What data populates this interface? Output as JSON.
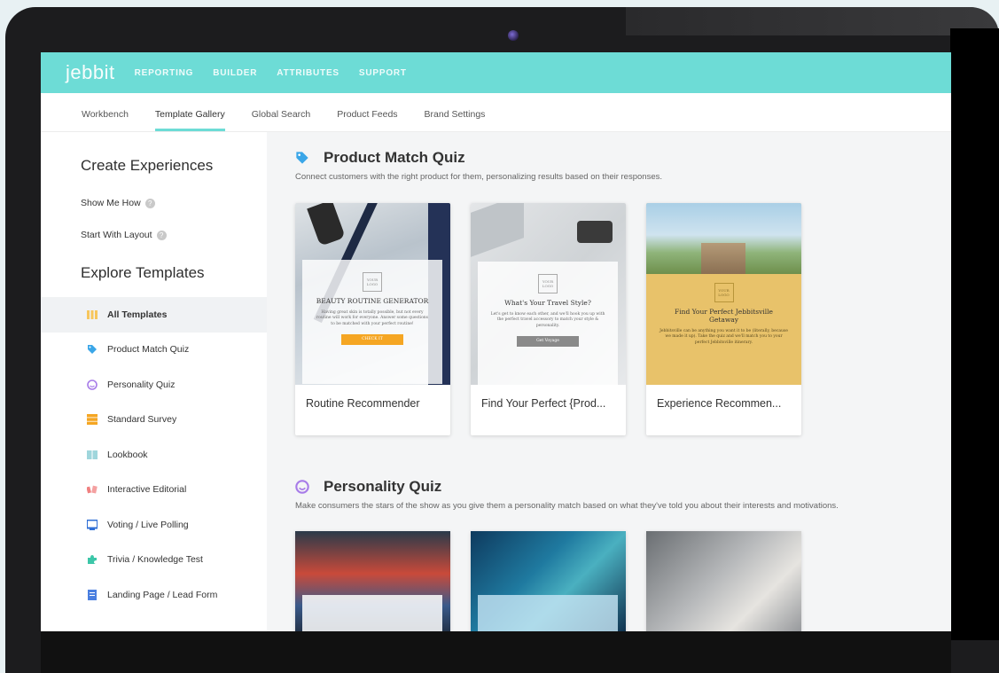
{
  "app": {
    "logo": "jebbit"
  },
  "topnav": [
    "REPORTING",
    "BUILDER",
    "ATTRIBUTES",
    "SUPPORT"
  ],
  "subnav": [
    "Workbench",
    "Template Gallery",
    "Global Search",
    "Product Feeds",
    "Brand Settings"
  ],
  "subnav_active": "Template Gallery",
  "sidebar": {
    "create_heading": "Create Experiences",
    "show_me_how": "Show Me How",
    "start_with_layout": "Start With Layout",
    "explore_heading": "Explore Templates",
    "items": [
      {
        "label": "All Templates",
        "icon": "grid-icon",
        "color": "#f7c65c"
      },
      {
        "label": "Product Match Quiz",
        "icon": "tag-icon",
        "color": "#3aa6e8"
      },
      {
        "label": "Personality Quiz",
        "icon": "smile-icon",
        "color": "#a77be8"
      },
      {
        "label": "Standard Survey",
        "icon": "survey-icon",
        "color": "#f5a623"
      },
      {
        "label": "Lookbook",
        "icon": "book-icon",
        "color": "#9fd6dc"
      },
      {
        "label": "Interactive Editorial",
        "icon": "editorial-icon",
        "color": "#f08080"
      },
      {
        "label": "Voting / Live Polling",
        "icon": "poll-icon",
        "color": "#2f6fd6"
      },
      {
        "label": "Trivia / Knowledge Test",
        "icon": "puzzle-icon",
        "color": "#3cc6a8"
      },
      {
        "label": "Landing Page / Lead Form",
        "icon": "form-icon",
        "color": "#4a7fe0"
      }
    ]
  },
  "sections": [
    {
      "title": "Product Match Quiz",
      "desc": "Connect customers with the right product for them, personalizing results based on their responses.",
      "cards": [
        {
          "title": "Routine Recommender",
          "overlay_logo": "YOUR LOGO",
          "overlay_title": "BEAUTY ROUTINE GENERATOR",
          "overlay_body": "Having great skin is totally possible, but not every routine will work for everyone. Answer some questions to be matched with your perfect routine!",
          "overlay_button": "CHECK IT"
        },
        {
          "title": "Find Your Perfect {Prod...",
          "overlay_logo": "YOUR LOGO",
          "overlay_title": "What's Your Travel Style?",
          "overlay_body": "Let's get to know each other, and we'll hook you up with the perfect travel accessory to match your style & personality.",
          "overlay_button": "Get Voyage"
        },
        {
          "title": "Experience Recommen...",
          "overlay_logo": "YOUR LOGO",
          "overlay_title": "Find Your Perfect Jebbitsville Getaway",
          "overlay_body": "Jebbitsville can be anything you want it to be (literally, because we made it up). Take the quiz and we'll match you to your perfect Jebbitsville itinerary."
        }
      ]
    },
    {
      "title": "Personality Quiz",
      "desc": "Make consumers the stars of the show as you give them a personality match based on what they've told you about their interests and motivations."
    }
  ],
  "colors": {
    "accent": "#6ddcd6",
    "beauty_button": "#f5a623",
    "travel_button": "#8a8a8a"
  }
}
